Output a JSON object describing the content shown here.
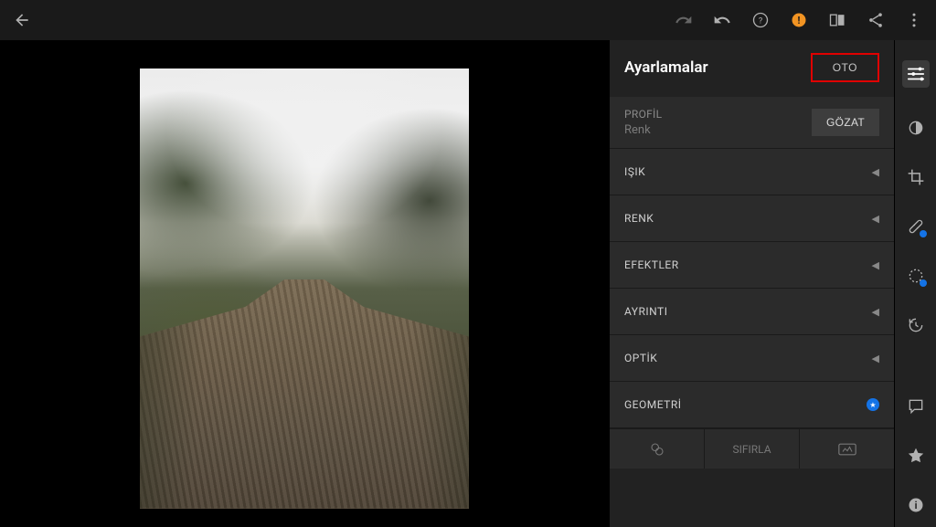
{
  "topbar": {
    "back": "←",
    "redo": "↷",
    "undo": "↶",
    "help": "?",
    "alert": "!",
    "compare": "◧",
    "share": "↗",
    "menu": "⋮"
  },
  "panel": {
    "title": "Ayarlamalar",
    "auto_label": "OTO",
    "profile_label": "PROFİL",
    "profile_value": "Renk",
    "browse_label": "GÖZAT",
    "sections": [
      {
        "label": "IŞIK"
      },
      {
        "label": "RENK"
      },
      {
        "label": "EFEKTLER"
      },
      {
        "label": "AYRINTI"
      },
      {
        "label": "OPTİK"
      },
      {
        "label": "GEOMETRİ"
      }
    ],
    "reset_label": "SIFIRLA"
  },
  "tools": {
    "adjust": "sliders",
    "masking": "mask",
    "crop": "crop",
    "healing": "bandage",
    "radial": "radial",
    "versions": "history",
    "comments": "chat",
    "star": "star",
    "info": "info"
  }
}
